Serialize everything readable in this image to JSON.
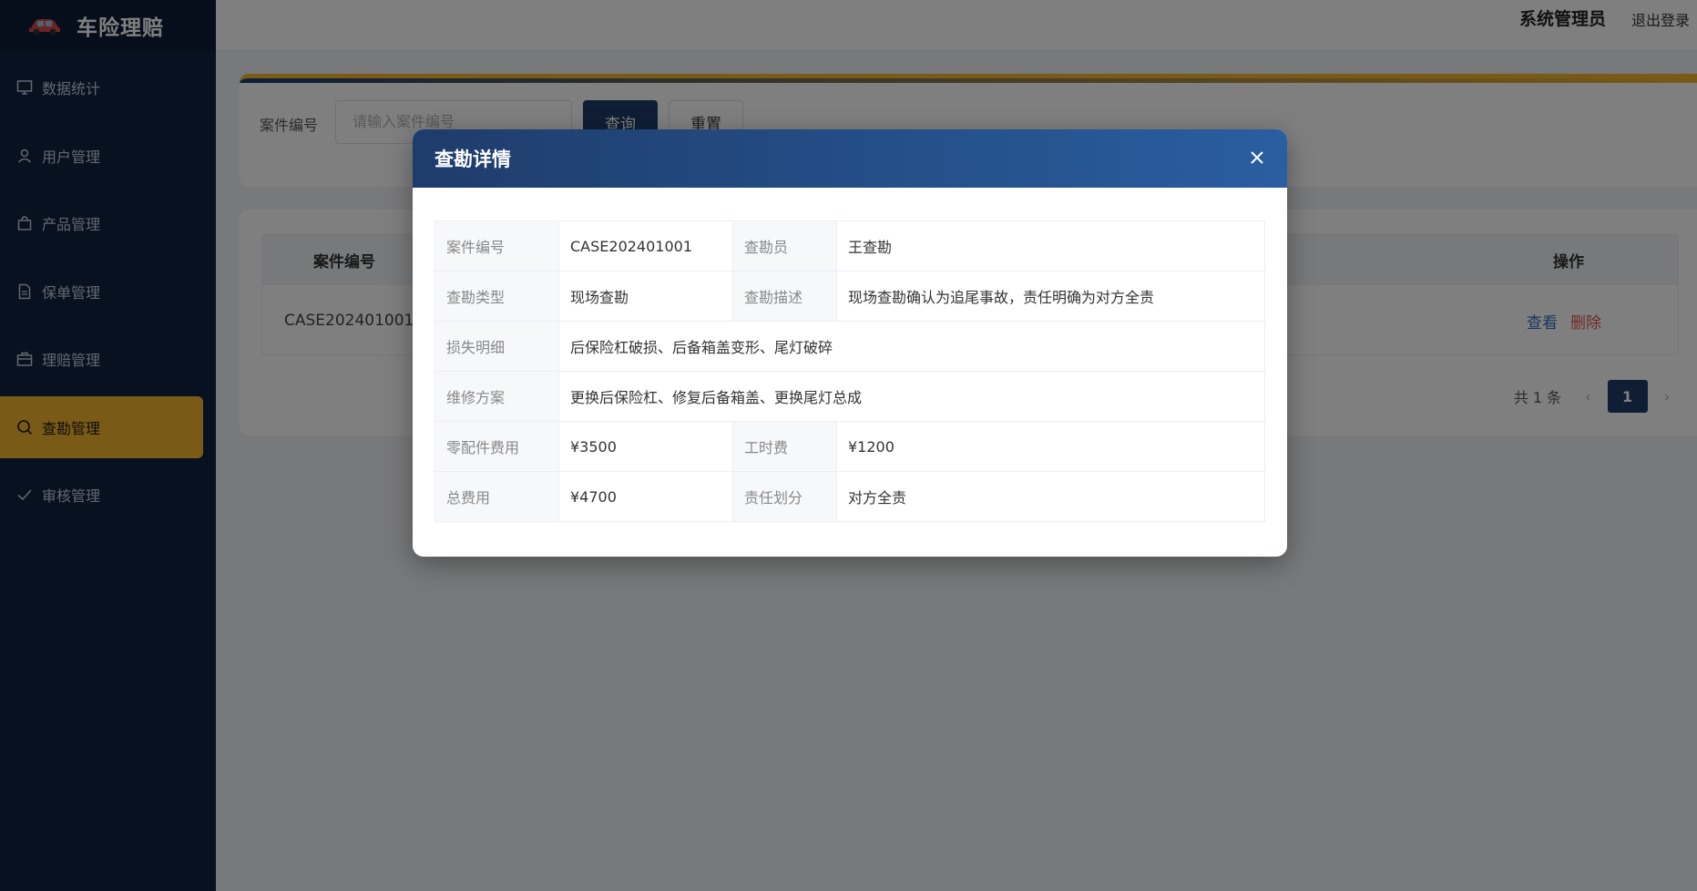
{
  "app": {
    "title": "车险理赔"
  },
  "sidebar": {
    "items": [
      {
        "label": "数据统计",
        "icon": "chart-icon"
      },
      {
        "label": "用户管理",
        "icon": "user-icon"
      },
      {
        "label": "产品管理",
        "icon": "bag-icon"
      },
      {
        "label": "保单管理",
        "icon": "document-icon"
      },
      {
        "label": "理赔管理",
        "icon": "briefcase-icon"
      },
      {
        "label": "查勘管理",
        "icon": "search-icon",
        "active": true
      },
      {
        "label": "审核管理",
        "icon": "check-icon"
      }
    ]
  },
  "header": {
    "user": "系统管理员",
    "logout": "退出登录"
  },
  "search": {
    "label": "案件编号",
    "placeholder": "请输入案件编号",
    "query": "查询",
    "reset": "重置"
  },
  "table": {
    "headers": [
      "案件编号",
      "操作"
    ],
    "rows": [
      {
        "case_no": "CASE202401001",
        "view": "查看",
        "delete": "删除"
      }
    ]
  },
  "pagination": {
    "total": "共 1 条",
    "current": "1"
  },
  "modal": {
    "title": "查勘详情",
    "fields": {
      "case_no_label": "案件编号",
      "case_no": "CASE202401001",
      "surveyor_label": "查勘员",
      "surveyor": "王查勘",
      "type_label": "查勘类型",
      "type": "现场查勘",
      "desc_label": "查勘描述",
      "desc": "现场查勘确认为追尾事故，责任明确为对方全责",
      "loss_label": "损失明细",
      "loss": "后保险杠破损、后备箱盖变形、尾灯破碎",
      "repair_label": "维修方案",
      "repair": "更换后保险杠、修复后备箱盖、更换尾灯总成",
      "parts_label": "零配件费用",
      "parts": "¥3500",
      "labor_label": "工时费",
      "labor": "¥1200",
      "total_label": "总费用",
      "total": "¥4700",
      "liability_label": "责任划分",
      "liability": "对方全责"
    }
  },
  "colors": {
    "sidebar": "#0f2340",
    "accent": "#f5b52e",
    "primary": "#1e3c6b",
    "danger": "#e0574f",
    "link": "#2f6fb8"
  }
}
